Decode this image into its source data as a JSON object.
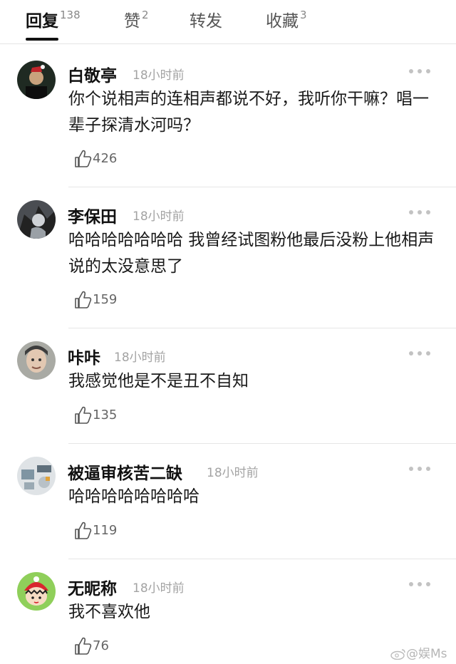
{
  "tabs": [
    {
      "label": "回复",
      "count": "138"
    },
    {
      "label": "赞",
      "count": "2"
    },
    {
      "label": "转发",
      "count": ""
    },
    {
      "label": "收藏",
      "count": "3"
    }
  ],
  "comments": [
    {
      "user": "白敬亭",
      "time": "18小时前",
      "text": "你个说相声的连相声都说不好，我听你干嘛？唱一辈子探清水河吗？",
      "likes": "426"
    },
    {
      "user": "李保田",
      "time": "18小时前",
      "text": "哈哈哈哈哈哈哈 我曾经试图粉他最后没粉上他相声说的太没意思了",
      "likes": "159"
    },
    {
      "user": "咔咔",
      "time": "18小时前",
      "text": "我感觉他是不是丑不自知",
      "likes": "135"
    },
    {
      "user": "被逼审核苦二缺",
      "time": "18小时前",
      "text": "哈哈哈哈哈哈哈哈",
      "likes": "119"
    },
    {
      "user": "无昵称",
      "time": "18小时前",
      "text": "我不喜欢他",
      "likes": "76"
    }
  ],
  "watermark": "@娱Ms",
  "icons": {
    "like": "thumbs-up-icon",
    "more": "more-dots-icon",
    "watermark": "weibo-logo-icon"
  }
}
